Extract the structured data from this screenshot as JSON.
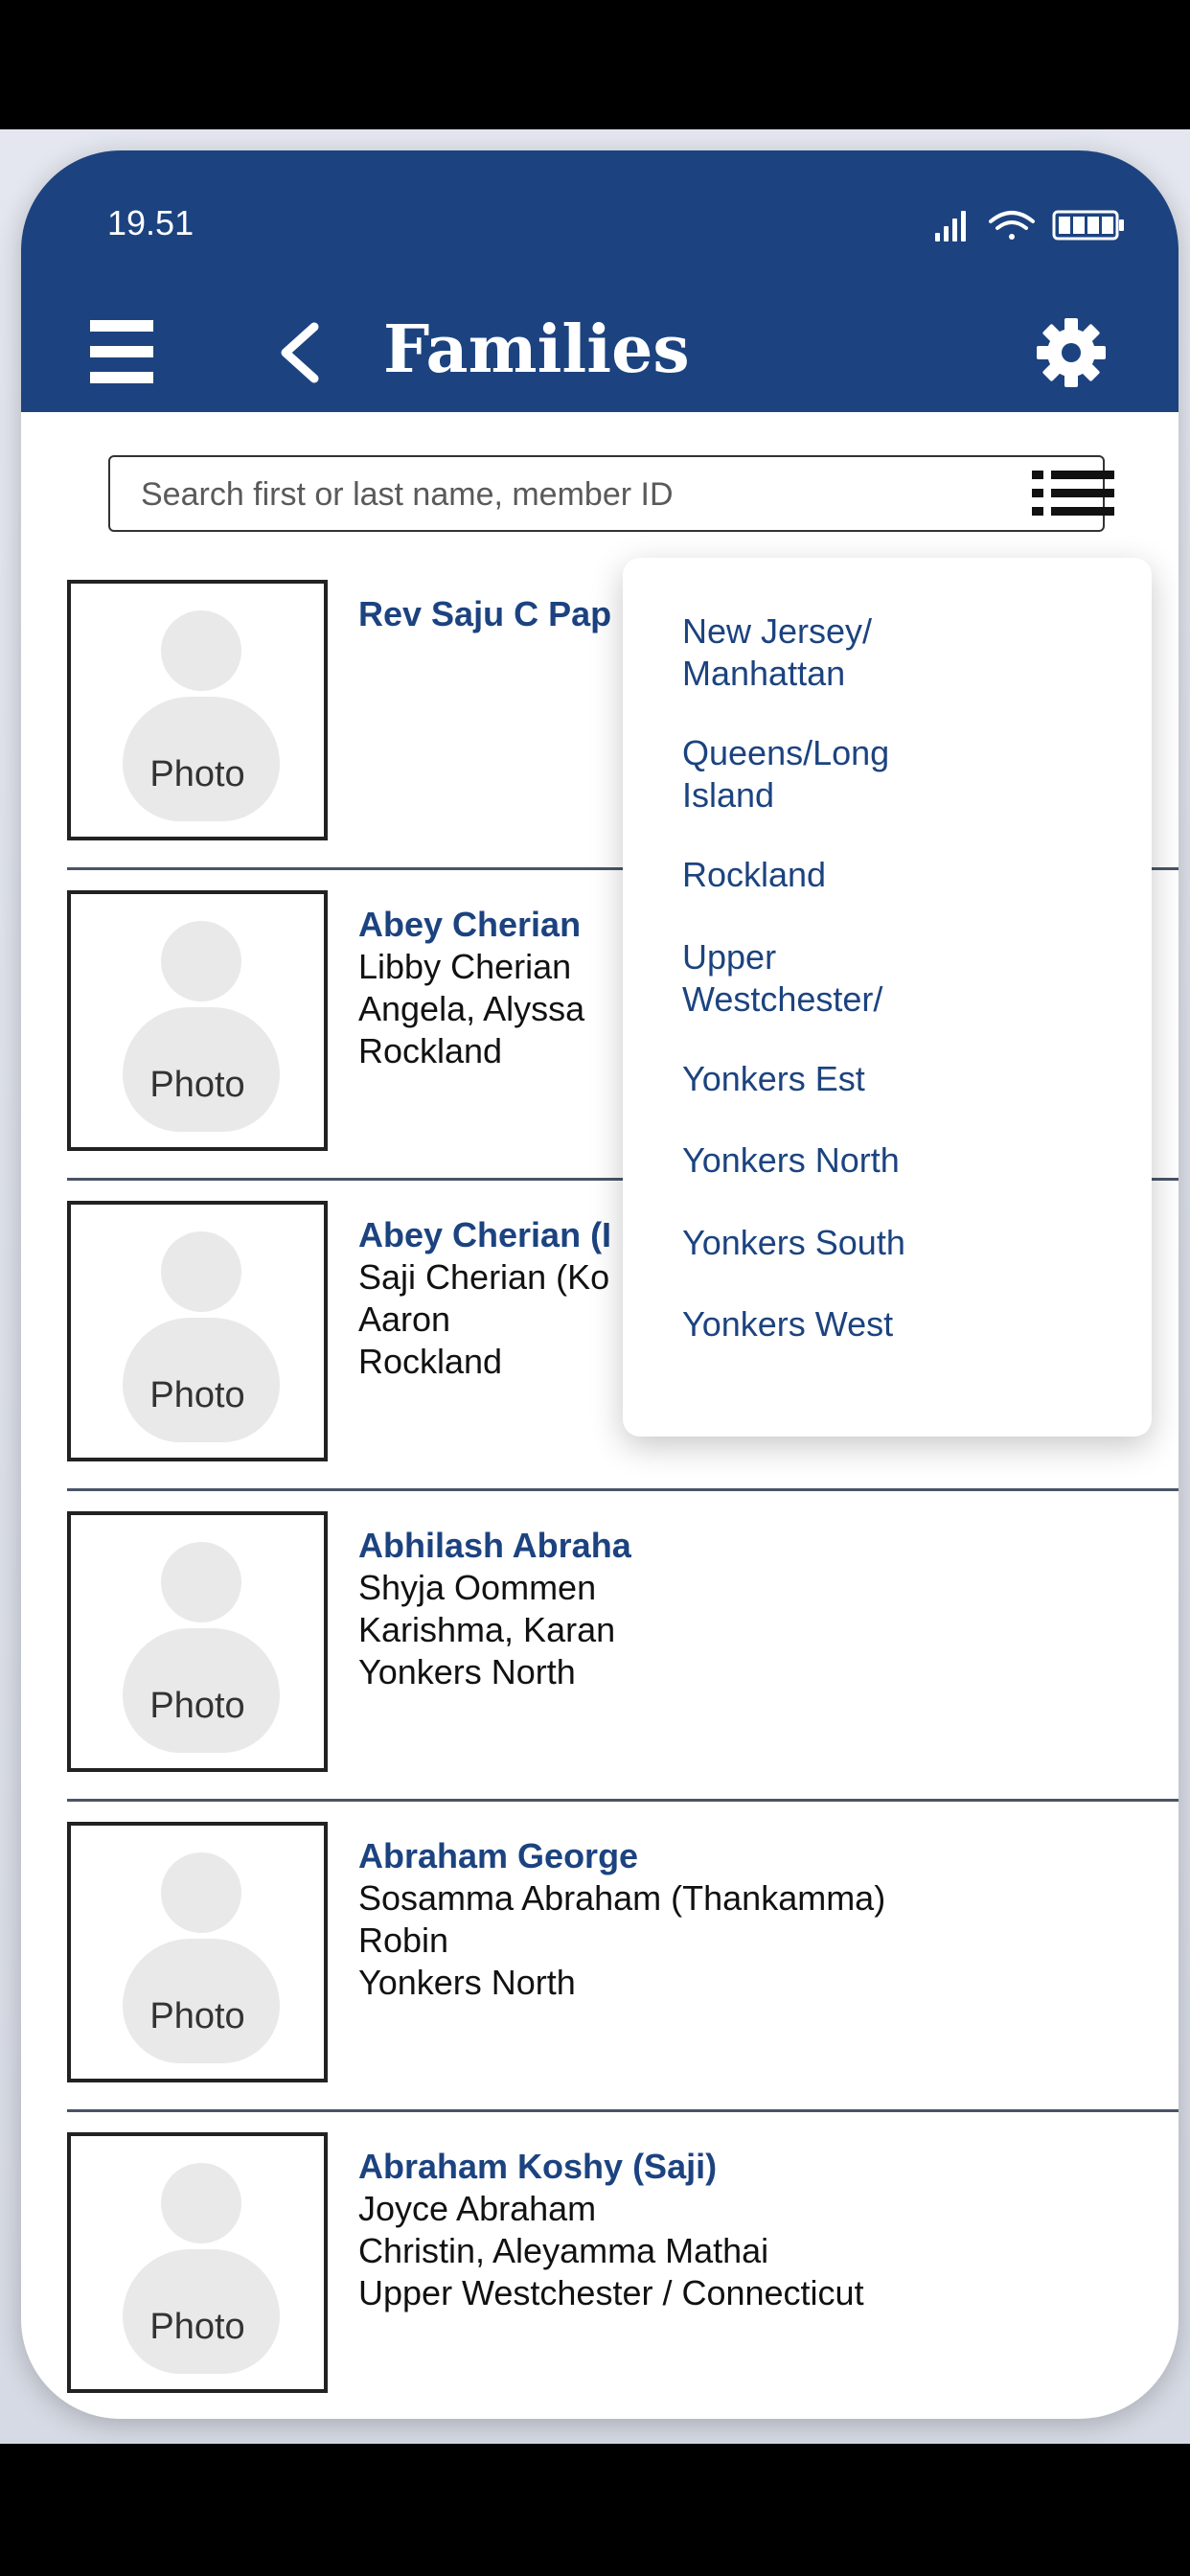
{
  "status_bar": {
    "time": "19.51"
  },
  "header": {
    "title": "Families"
  },
  "search": {
    "placeholder": "Search first or last name, member ID"
  },
  "families": [
    {
      "name": "Rev Saju C Pap",
      "spouse": "",
      "children": "",
      "region": ""
    },
    {
      "name": "Abey Cherian",
      "spouse": "Libby Cherian",
      "children": "Angela, Alyssa",
      "region": "Rockland"
    },
    {
      "name": "Abey Cherian (I",
      "spouse": "Saji Cherian (Ko",
      "children": "Aaron",
      "region": "Rockland"
    },
    {
      "name": "Abhilash Abraha",
      "spouse": "Shyja Oommen",
      "children": "Karishma, Karan",
      "region": "Yonkers North"
    },
    {
      "name": "Abraham George",
      "spouse": "Sosamma Abraham (Thankamma)",
      "children": "Robin",
      "region": "Yonkers North"
    },
    {
      "name": "Abraham Koshy (Saji)",
      "spouse": "Joyce Abraham",
      "children": "Christin, Aleyamma Mathai",
      "region": "Upper Westchester / Connecticut"
    }
  ],
  "photo_label": "Photo",
  "region_filter": {
    "options": [
      {
        "line1": "New Jersey/",
        "line2": "Manhattan"
      },
      {
        "line1": "Queens/Long",
        "line2": "Island"
      },
      {
        "line1": "Rockland",
        "line2": ""
      },
      {
        "line1": "Upper",
        "line2": "Westchester/"
      },
      {
        "line1": "Yonkers Est",
        "line2": ""
      },
      {
        "line1": "Yonkers North",
        "line2": ""
      },
      {
        "line1": "Yonkers South",
        "line2": ""
      },
      {
        "line1": "Yonkers West",
        "line2": ""
      }
    ]
  },
  "colors": {
    "brand": "#1c4380",
    "divider": "#4a5468",
    "avatar": "#e9e9e9"
  },
  "icons": [
    "menu-icon",
    "back-icon",
    "gear-icon",
    "list-icon",
    "signal-icon",
    "wifi-icon",
    "battery-icon",
    "avatar-placeholder-icon"
  ]
}
